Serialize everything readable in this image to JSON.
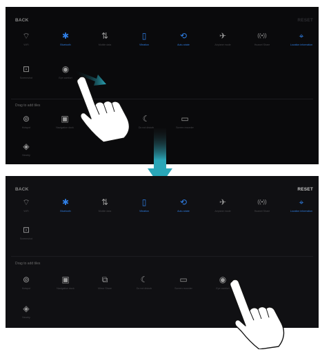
{
  "colors": {
    "accent": "#2f7fe6",
    "dim_icon": "#9a9a9a",
    "dim_text": "#4a4a4e",
    "reset_dim": "#2e2e32",
    "reset_bright": "#c8c8c8",
    "arrow_teal": "#2aa6b8"
  },
  "panel_top": {
    "back": "BACK",
    "reset": "RESET",
    "active_tiles": [
      {
        "icon": "wifi-icon",
        "label": "WiFi",
        "glyph": "⌔",
        "on": false
      },
      {
        "icon": "bluetooth-icon",
        "label": "Bluetooth",
        "glyph": "✱",
        "on": true
      },
      {
        "icon": "mobile-data-icon",
        "label": "Mobile data",
        "glyph": "⇅",
        "on": false
      },
      {
        "icon": "vibration-icon",
        "label": "Vibration",
        "glyph": "▯",
        "on": true
      },
      {
        "icon": "auto-rotate-icon",
        "label": "Auto-rotate",
        "glyph": "⟲",
        "on": true
      },
      {
        "icon": "airplane-icon",
        "label": "Airplane mode",
        "glyph": "✈",
        "on": false
      },
      {
        "icon": "hotspot-share-icon",
        "label": "Huawei Share",
        "glyph": "((•))",
        "on": false
      },
      {
        "icon": "location-icon",
        "label": "Location information",
        "glyph": "⌖",
        "on": true
      },
      {
        "icon": "screenshot-icon",
        "label": "Screenshot",
        "glyph": "⊡",
        "on": false
      },
      {
        "icon": "eye-comfort-icon",
        "label": "Eye comfort",
        "glyph": "◉",
        "on": false
      }
    ],
    "drag_label": "Drag to add tiles",
    "inactive_tiles": [
      {
        "icon": "hotspot-icon",
        "label": "Hotspot",
        "glyph": "⊚"
      },
      {
        "icon": "navigation-dock-icon",
        "label": "Navigation dock",
        "glyph": "▣"
      },
      {
        "icon": "do-not-disturb-icon",
        "label": "Do not disturb",
        "glyph": "☾"
      },
      {
        "icon": "screen-recorder-icon",
        "label": "Screen recorder",
        "glyph": "▭"
      },
      {
        "icon": "nearby-icon",
        "label": "Nearby",
        "glyph": "◈"
      }
    ]
  },
  "panel_bottom": {
    "back": "BACK",
    "reset": "RESET",
    "active_tiles": [
      {
        "icon": "wifi-icon",
        "label": "WiFi",
        "glyph": "⌔",
        "on": false
      },
      {
        "icon": "bluetooth-icon",
        "label": "Bluetooth",
        "glyph": "✱",
        "on": true
      },
      {
        "icon": "mobile-data-icon",
        "label": "Mobile data",
        "glyph": "⇅",
        "on": false
      },
      {
        "icon": "vibration-icon",
        "label": "Vibration",
        "glyph": "▯",
        "on": true
      },
      {
        "icon": "auto-rotate-icon",
        "label": "Auto-rotate",
        "glyph": "⟲",
        "on": true
      },
      {
        "icon": "airplane-icon",
        "label": "Airplane mode",
        "glyph": "✈",
        "on": false
      },
      {
        "icon": "hotspot-share-icon",
        "label": "Huawei Share",
        "glyph": "((•))",
        "on": false
      },
      {
        "icon": "location-icon",
        "label": "Location information",
        "glyph": "⌖",
        "on": true
      },
      {
        "icon": "screenshot-icon",
        "label": "Screenshot",
        "glyph": "⊡",
        "on": false
      }
    ],
    "drag_label": "Drag to add tiles",
    "inactive_tiles": [
      {
        "icon": "hotspot-icon",
        "label": "Hotspot",
        "glyph": "⊚"
      },
      {
        "icon": "navigation-dock-icon",
        "label": "Navigation dock",
        "glyph": "▣"
      },
      {
        "icon": "mirror-share-icon",
        "label": "Mirror Share",
        "glyph": "⧉"
      },
      {
        "icon": "do-not-disturb-icon",
        "label": "Do not disturb",
        "glyph": "☾"
      },
      {
        "icon": "screen-recorder-icon",
        "label": "Screen recorder",
        "glyph": "▭"
      },
      {
        "icon": "eye-comfort-icon",
        "label": "Eye comfort",
        "glyph": "◉"
      },
      {
        "icon": "nearby-icon",
        "label": "Nearby",
        "glyph": "◈"
      }
    ]
  }
}
